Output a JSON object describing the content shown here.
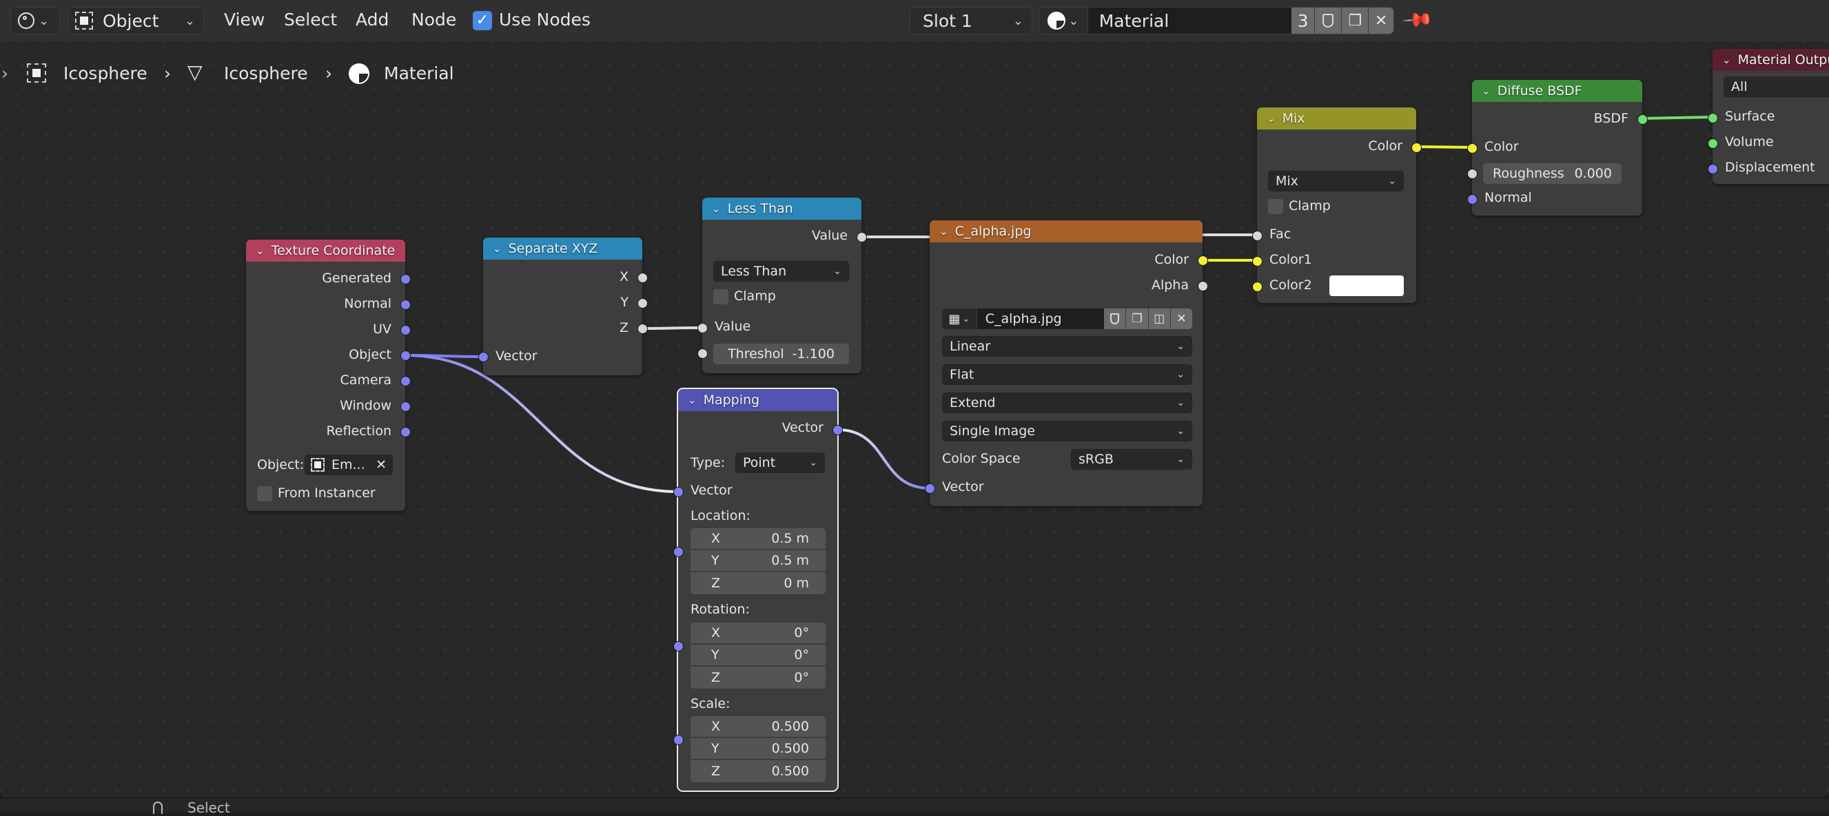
{
  "header": {
    "editor_type_icon": "node-editor-icon",
    "object_mode": "Object",
    "menus": [
      "View",
      "Select",
      "Add",
      "Node"
    ],
    "use_nodes": {
      "label": "Use Nodes",
      "checked": true
    },
    "slot": "Slot 1",
    "material_name": "Material",
    "user_count": "3",
    "icons": [
      "fake-user-shield-icon",
      "duplicate-icon",
      "unlink-x-icon",
      "pin-icon"
    ]
  },
  "breadcrumb": [
    "Icosphere",
    "Icosphere",
    "Material"
  ],
  "status_bar": {
    "hint": "Select"
  },
  "colors": {
    "texcoord_header": "#b33f5f",
    "separate_header": "#2b87b8",
    "lessthan_header": "#2b87b8",
    "mapping_header": "#5353b3",
    "image_header": "#a8602a",
    "mix_header": "#959527",
    "diffuse_header": "#3a8a3a",
    "output_header": "#5a2030",
    "socket_vector": "#8080f0",
    "socket_float": "#d6d6d6",
    "socket_color": "#f0f030",
    "socket_shader": "#6ee06e"
  },
  "nodes": {
    "texcoord": {
      "title": "Texture Coordinate",
      "outputs": [
        "Generated",
        "Normal",
        "UV",
        "Object",
        "Camera",
        "Window",
        "Reflection"
      ],
      "object_label": "Object:",
      "object_value": "Em...",
      "from_instancer": {
        "label": "From Instancer",
        "checked": false
      }
    },
    "separate": {
      "title": "Separate XYZ",
      "outputs": [
        "X",
        "Y",
        "Z"
      ],
      "input": "Vector"
    },
    "lessthan": {
      "title": "Less Than",
      "output": "Value",
      "operation": "Less Than",
      "clamp": {
        "label": "Clamp",
        "checked": false
      },
      "input_value": "Value",
      "threshold_label": "Threshol",
      "threshold_value": "-1.100"
    },
    "mapping": {
      "title": "Mapping",
      "output": "Vector",
      "type_label": "Type:",
      "type_value": "Point",
      "input": "Vector",
      "location_label": "Location:",
      "location": [
        {
          "axis": "X",
          "value": "0.5 m"
        },
        {
          "axis": "Y",
          "value": "0.5 m"
        },
        {
          "axis": "Z",
          "value": "0 m"
        }
      ],
      "rotation_label": "Rotation:",
      "rotation": [
        {
          "axis": "X",
          "value": "0°"
        },
        {
          "axis": "Y",
          "value": "0°"
        },
        {
          "axis": "Z",
          "value": "0°"
        }
      ],
      "scale_label": "Scale:",
      "scale": [
        {
          "axis": "X",
          "value": "0.500"
        },
        {
          "axis": "Y",
          "value": "0.500"
        },
        {
          "axis": "Z",
          "value": "0.500"
        }
      ]
    },
    "image": {
      "title": "C_alpha.jpg",
      "outputs": [
        "Color",
        "Alpha"
      ],
      "image_name": "C_alpha.jpg",
      "interpolation": "Linear",
      "projection": "Flat",
      "extension": "Extend",
      "source": "Single Image",
      "color_space_label": "Color Space",
      "color_space": "sRGB",
      "input": "Vector"
    },
    "mix": {
      "title": "Mix",
      "output": "Color",
      "blend": "Mix",
      "clamp": {
        "label": "Clamp",
        "checked": false
      },
      "inputs": [
        "Fac",
        "Color1",
        "Color2"
      ],
      "color2_swatch": "#ffffff"
    },
    "diffuse": {
      "title": "Diffuse BSDF",
      "output": "BSDF",
      "input_color": "Color",
      "roughness_label": "Roughness",
      "roughness_value": "0.000",
      "input_normal": "Normal"
    },
    "output": {
      "title": "Material Output",
      "target": "All",
      "inputs": [
        "Surface",
        "Volume",
        "Displacement"
      ]
    }
  }
}
